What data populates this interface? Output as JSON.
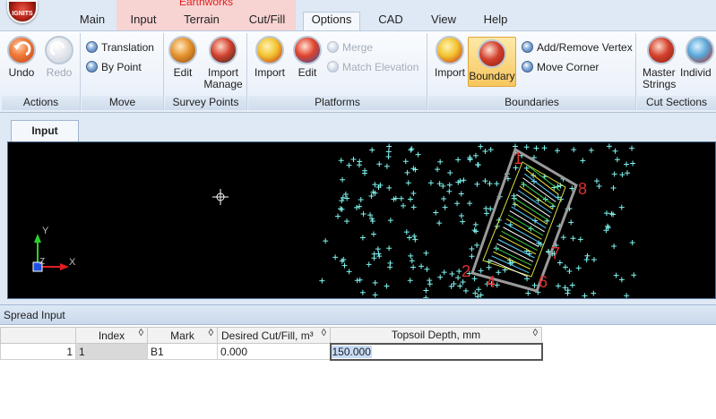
{
  "app": {
    "logo_text": "IGNITS"
  },
  "context_tab_label": "Earthworks",
  "tabs": [
    {
      "label": "Main"
    },
    {
      "label": "Input"
    },
    {
      "label": "Terrain"
    },
    {
      "label": "Cut/Fill"
    },
    {
      "label": "Options"
    },
    {
      "label": "CAD"
    },
    {
      "label": "View"
    },
    {
      "label": "Help"
    }
  ],
  "active_tab": "Input",
  "ribbon": {
    "groups": [
      {
        "label": "Actions",
        "buttons": {
          "undo": "Undo",
          "redo": "Redo"
        }
      },
      {
        "label": "Move",
        "buttons": {
          "translation": "Translation",
          "by_point": "By Point"
        }
      },
      {
        "label": "Survey Points",
        "buttons": {
          "edit": "Edit",
          "import_manage_line1": "Import",
          "import_manage_line2": "Manage"
        }
      },
      {
        "label": "Platforms",
        "buttons": {
          "import": "Import",
          "edit": "Edit",
          "merge": "Merge",
          "match_elevation": "Match Elevation"
        }
      },
      {
        "label": "Boundaries",
        "buttons": {
          "import": "Import",
          "boundary": "Boundary",
          "add_remove_vertex": "Add/Remove Vertex",
          "move_corner": "Move Corner"
        }
      },
      {
        "label": "Cut Sections",
        "buttons": {
          "master_strings_line1": "Master",
          "master_strings_line2": "Strings",
          "individual": "Individ"
        }
      }
    ]
  },
  "document_tab": "Input",
  "viewport": {
    "axis_labels": {
      "y": "Y",
      "x": "X",
      "z": "Z"
    },
    "boundary_numbers": [
      "1",
      "2",
      "4",
      "6",
      "7",
      "8"
    ],
    "colors": {
      "background": "#000000",
      "points": "#7ff5f0",
      "boundary": "#8a8a8a",
      "labels": "#e03030"
    }
  },
  "spread_input": {
    "title": "Spread Input",
    "columns": [
      "Index",
      "Mark",
      "Desired Cut/Fill, m³",
      "Topsoil Depth, mm"
    ],
    "rows": [
      {
        "row_number": "1",
        "index": "1",
        "mark": "B1",
        "desired_cut_fill": "0.000",
        "topsoil_depth": "150.000"
      }
    ]
  }
}
